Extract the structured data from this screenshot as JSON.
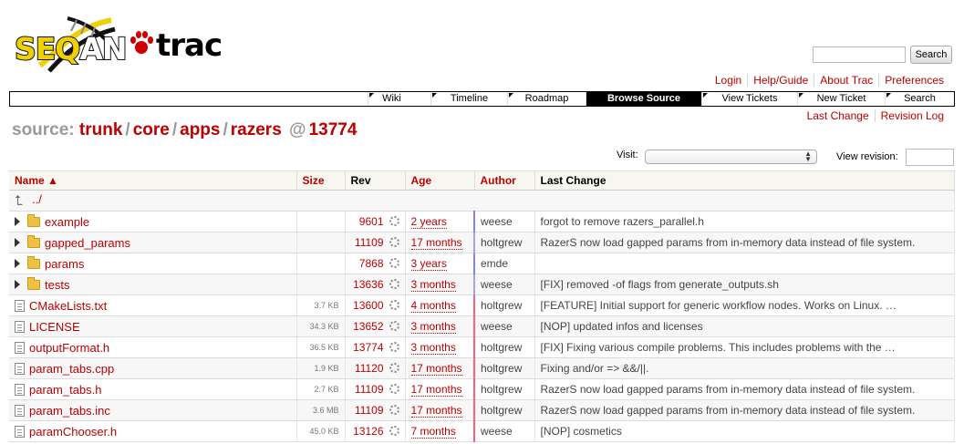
{
  "logo": {
    "seq": "SEQ",
    "an": "AN",
    "trac": "trac"
  },
  "search": {
    "placeholder": "",
    "button": "Search"
  },
  "metanav": [
    "Login",
    "Help/Guide",
    "About Trac",
    "Preferences"
  ],
  "mainnav": [
    "Wiki",
    "Timeline",
    "Roadmap",
    "Browse Source",
    "View Tickets",
    "New Ticket",
    "Search"
  ],
  "mainnav_active": "Browse Source",
  "ctxnav": [
    "Last Change",
    "Revision Log"
  ],
  "path": {
    "prefix": "source:",
    "segments": [
      "trunk",
      "core",
      "apps",
      "razers"
    ],
    "at": "@",
    "rev": "13774"
  },
  "visit": {
    "label": "Visit:",
    "value": ""
  },
  "view_revision": {
    "label": "View revision:",
    "value": ""
  },
  "table": {
    "headers": {
      "name": "Name ▲",
      "size": "Size",
      "rev": "Rev",
      "age": "Age",
      "author": "Author",
      "change": "Last Change"
    },
    "parent": "../",
    "rows": [
      {
        "type": "dir",
        "name": "example",
        "size": "",
        "rev": "9601",
        "age": "2 years",
        "author": "weese",
        "change": "forgot to remove razers_parallel.h"
      },
      {
        "type": "dir",
        "name": "gapped_params",
        "size": "",
        "rev": "11109",
        "age": "17 months",
        "author": "holtgrew",
        "change": "RazerS now load gapped params from in-memory data instead of file system."
      },
      {
        "type": "dir",
        "name": "params",
        "size": "",
        "rev": "7868",
        "age": "3 years",
        "author": "emde",
        "change": ""
      },
      {
        "type": "dir",
        "name": "tests",
        "size": "",
        "rev": "13636",
        "age": "3 months",
        "author": "weese",
        "change": "[FIX] removed -of flags from generate_outputs.sh"
      },
      {
        "type": "file",
        "name": "CMakeLists.txt",
        "size": "3.7 KB",
        "rev": "13600",
        "age": "4 months",
        "author": "holtgrew",
        "change": "[FEATURE] Initial support for generic workflow nodes. Works on Linux. …"
      },
      {
        "type": "file",
        "name": "LICENSE",
        "size": "34.3 KB",
        "rev": "13652",
        "age": "3 months",
        "author": "weese",
        "change": "[NOP] updated infos and licenses"
      },
      {
        "type": "file",
        "name": "outputFormat.h",
        "size": "36.5 KB",
        "rev": "13774",
        "age": "3 months",
        "author": "holtgrew",
        "change": "[FIX] Fixing various compile problems. This includes problems with the …"
      },
      {
        "type": "file",
        "name": "param_tabs.cpp",
        "size": "1.9 KB",
        "rev": "11120",
        "age": "17 months",
        "author": "holtgrew",
        "change": "Fixing and/or => &&/||."
      },
      {
        "type": "file",
        "name": "param_tabs.h",
        "size": "2.7 KB",
        "rev": "11109",
        "age": "17 months",
        "author": "holtgrew",
        "change": "RazerS now load gapped params from in-memory data instead of file system."
      },
      {
        "type": "file",
        "name": "param_tabs.inc",
        "size": "3.6 MB",
        "rev": "11109",
        "age": "17 months",
        "author": "holtgrew",
        "change": "RazerS now load gapped params from in-memory data instead of file system."
      },
      {
        "type": "file",
        "name": "paramChooser.h",
        "size": "45.0 KB",
        "rev": "13126",
        "age": "7 months",
        "author": "weese",
        "change": "[NOP] cosmetics"
      }
    ]
  },
  "colors": {
    "link": "#bb0000",
    "age_new": "#ff4060",
    "age_old": "#8080ff"
  }
}
